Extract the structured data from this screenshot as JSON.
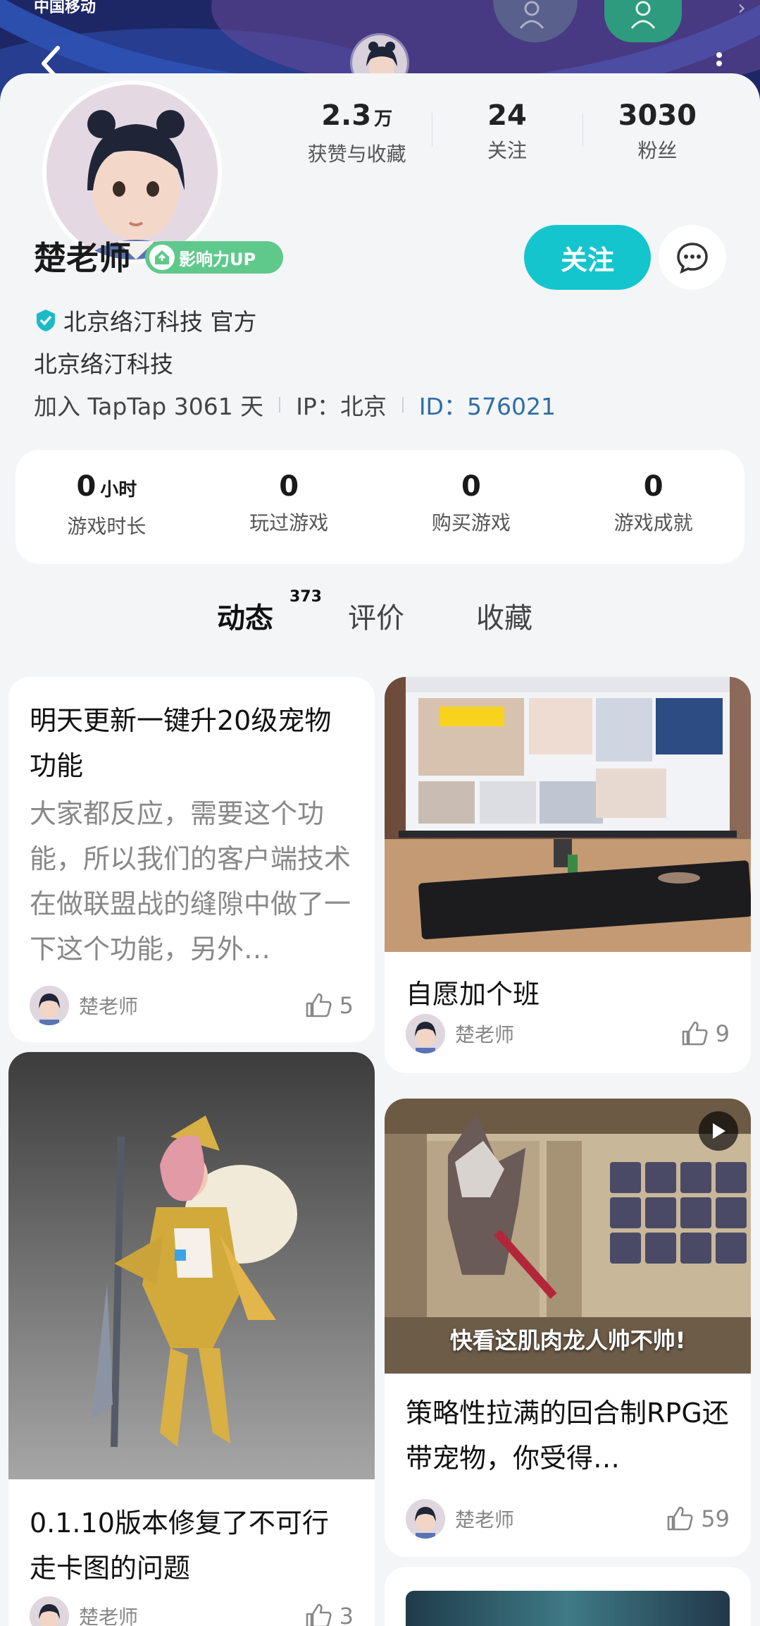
{
  "status": {
    "carrier": "中国移动"
  },
  "header": {
    "back_icon": "chevron-left-icon",
    "more_icon": "more-vertical-icon"
  },
  "profile": {
    "name": "楚老师",
    "badge": "影响力UP",
    "stats": [
      {
        "value": "2.3",
        "unit": "万",
        "label": "获赞与收藏"
      },
      {
        "value": "24",
        "unit": "",
        "label": "关注"
      },
      {
        "value": "3030",
        "unit": "",
        "label": "粉丝"
      }
    ],
    "follow_label": "关注",
    "verified": "北京络汀科技 官方",
    "company": "北京络汀科技",
    "joined": "加入 TapTap 3061 天",
    "ip": "IP：北京",
    "id": "ID：576021"
  },
  "games": [
    {
      "value": "0",
      "unit": "小时",
      "label": "游戏时长"
    },
    {
      "value": "0",
      "unit": "",
      "label": "玩过游戏"
    },
    {
      "value": "0",
      "unit": "",
      "label": "购买游戏"
    },
    {
      "value": "0",
      "unit": "",
      "label": "游戏成就"
    }
  ],
  "tabs": [
    {
      "label": "动态",
      "count": "373",
      "active": true
    },
    {
      "label": "评价"
    },
    {
      "label": "收藏"
    }
  ],
  "posts": [
    {
      "title": "明天更新一键升20级宠物功能",
      "body": "大家都反应，需要这个功能，所以我们的客户端技术在做联盟战的缝隙中做了一下这个功能，另外…",
      "author": "楚老师",
      "likes": "5"
    },
    {
      "title": "自愿加个班",
      "author": "楚老师",
      "likes": "9",
      "image": "photo-monitor-desk"
    },
    {
      "title": "0.1.10版本修复了不可行走卡图的问题",
      "author": "楚老师",
      "likes": "3",
      "image": "art-armored-knight"
    },
    {
      "title": "策略性拉满的回合制RPG还带宠物，你受得…",
      "author": "楚老师",
      "likes": "59",
      "image": "video-game-screenshot",
      "caption": "快看这肌肉龙人帅不帅!"
    }
  ],
  "colors": {
    "accent": "#15c5ce",
    "badge": "#5fc98c",
    "id_link": "#2f6da8",
    "banner": "#1d2766"
  }
}
